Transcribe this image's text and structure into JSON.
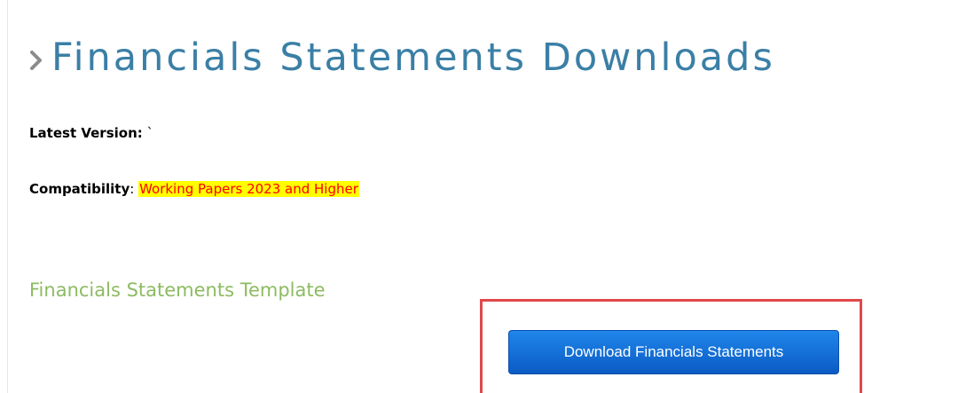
{
  "page": {
    "title": "Financials Statements Downloads"
  },
  "info": {
    "latest_version_label": "Latest Version",
    "latest_version_separator": ":",
    "latest_version_value": "`",
    "compatibility_label": "Compatibility",
    "compatibility_separator": ":",
    "compatibility_value": "Working Papers 2023 and Higher"
  },
  "section": {
    "title": "Financials Statements Template"
  },
  "download": {
    "button_label": "Download Financials Statements"
  },
  "icons": {
    "heading": "chevron-right-icon"
  },
  "colors": {
    "heading": "#3a7fa6",
    "section_heading": "#8dbb62",
    "highlight_bg": "#ffff00",
    "highlight_text": "#ff0000",
    "callout_border": "#e0484a",
    "button_bg": "#1166d6"
  }
}
